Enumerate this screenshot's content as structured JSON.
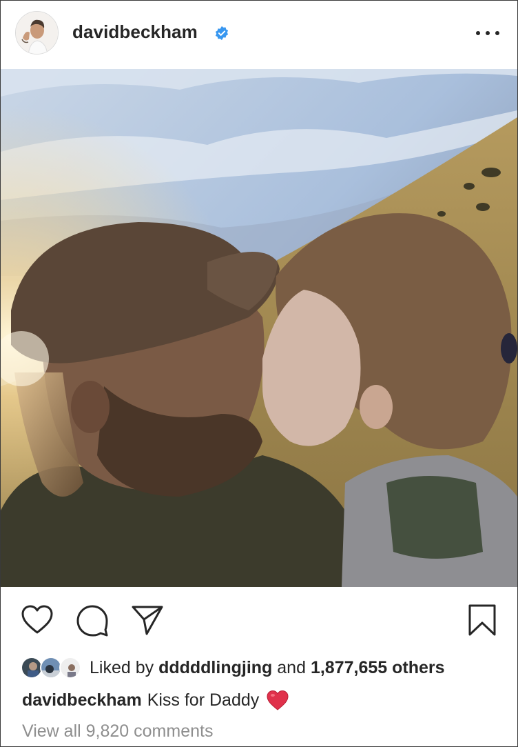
{
  "post": {
    "username": "davidbeckham",
    "verified": true,
    "more_icon": "more-horizontal-icon"
  },
  "actions": {
    "like_icon": "heart-icon",
    "comment_icon": "comment-icon",
    "share_icon": "send-icon",
    "save_icon": "bookmark-icon"
  },
  "likes": {
    "prefix": "Liked by",
    "liked_by_user": "dddddlingjing",
    "and_text": "and",
    "others_count": "1,877,655 others"
  },
  "caption": {
    "username": "davidbeckham",
    "text": "Kiss for Daddy",
    "emoji": "red-heart-emoji"
  },
  "comments": {
    "view_all": "View all 9,820 comments"
  },
  "colors": {
    "text": "#262626",
    "muted": "#8e8e8e",
    "verified_blue": "#3897f0",
    "heart_red": "#e0245e"
  }
}
